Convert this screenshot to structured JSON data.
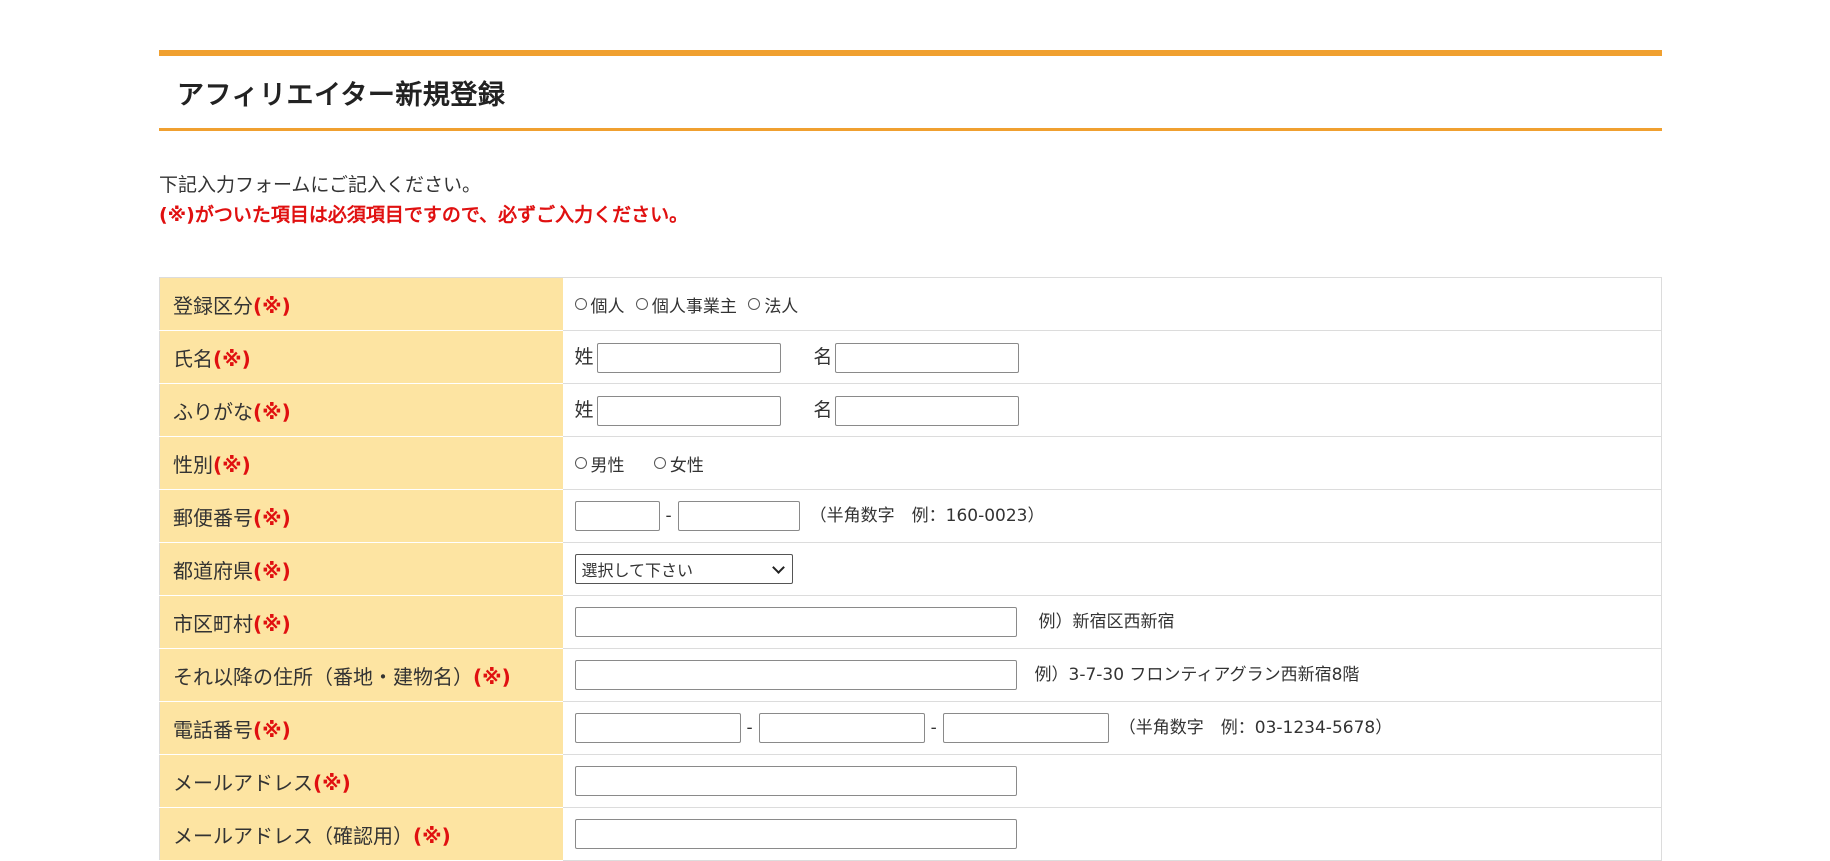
{
  "page": {
    "title": "アフィリエイター新規登録",
    "intro": "下記入力フォームにご記入ください。",
    "required_note": "(※)がついた項目は必須項目ですので、必ずご入力ください。"
  },
  "required_mark": "(※)",
  "form": {
    "registration_type": {
      "label": "登録区分",
      "options": [
        "個人",
        "個人事業主",
        "法人"
      ]
    },
    "name": {
      "label": "氏名",
      "last_label": "姓",
      "first_label": "名",
      "last_value": "",
      "first_value": ""
    },
    "furigana": {
      "label": "ふりがな",
      "last_label": "姓",
      "first_label": "名",
      "last_value": "",
      "first_value": ""
    },
    "gender": {
      "label": "性別",
      "options": [
        "男性",
        "女性"
      ]
    },
    "postal_code": {
      "label": "郵便番号",
      "separator": "-",
      "hint": "（半角数字　例：160-0023）"
    },
    "prefecture": {
      "label": "都道府県",
      "selected": "選択して下さい"
    },
    "city": {
      "label": "市区町村",
      "hint": "例）新宿区西新宿"
    },
    "address_rest": {
      "label": "それ以降の住所（番地・建物名）",
      "hint": "例）3-7-30 フロンティアグラン西新宿8階"
    },
    "phone": {
      "label": "電話番号",
      "separator": "-",
      "hint": "（半角数字　例：03-1234-5678）"
    },
    "email": {
      "label": "メールアドレス"
    },
    "email_confirm": {
      "label": "メールアドレス（確認用）"
    }
  }
}
